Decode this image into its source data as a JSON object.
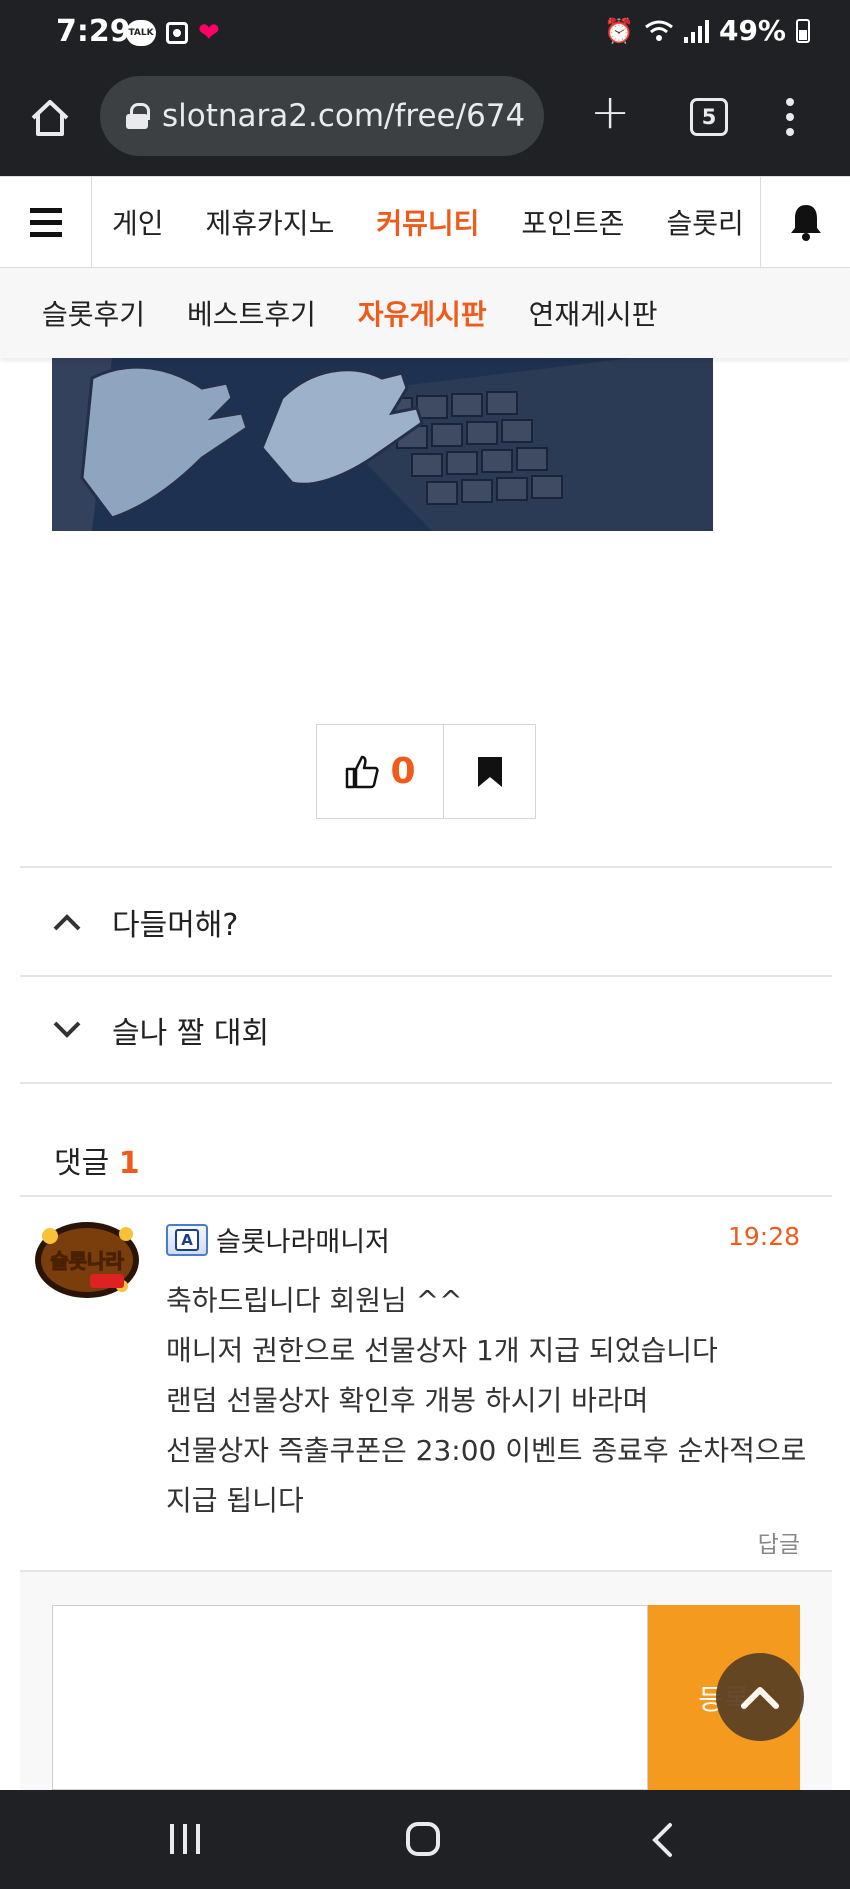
{
  "status_bar": {
    "time": "7:29",
    "battery": "49%",
    "left_icons": [
      "kakaotalk-icon",
      "camera-app-icon",
      "heart-icon"
    ],
    "right_icons": [
      "alarm-icon",
      "wifi-icon",
      "signal-icon",
      "battery-icon"
    ]
  },
  "browser": {
    "url": "slotnara2.com/free/674",
    "tab_count": "5"
  },
  "site_nav": {
    "items": [
      {
        "label": "게인",
        "active": false
      },
      {
        "label": "제휴카지노",
        "active": false
      },
      {
        "label": "커뮤니티",
        "active": true
      },
      {
        "label": "포인트존",
        "active": false
      },
      {
        "label": "슬롯리",
        "active": false
      }
    ]
  },
  "sub_nav": {
    "items": [
      {
        "label": "슬롯후기",
        "active": false
      },
      {
        "label": "베스트후기",
        "active": false
      },
      {
        "label": "자유게시판",
        "active": true
      },
      {
        "label": "연재게시판",
        "active": false
      }
    ]
  },
  "post_actions": {
    "like_count": "0"
  },
  "prev_next": {
    "prev_title": "다들머해?",
    "next_title": "슬나 짤 대회"
  },
  "comments": {
    "label": "댓글",
    "count": "1",
    "items": [
      {
        "author": "슬롯나라매니저",
        "badge": "A",
        "avatar_text": "슬롯나라",
        "time": "19:28",
        "lines": [
          "축하드립니다 회원님 ^^",
          "매니저 권한으로 선물상자 1개 지급 되었습니다",
          "랜덤 선물상자 확인후 개봉 하시기 바라며",
          "선물상자 즉출쿠폰은 23:00 이벤트 종료후 순차적으로",
          "지급 됩니다"
        ],
        "reply_label": "답글"
      }
    ]
  },
  "comment_form": {
    "submit_label": "등록"
  },
  "colors": {
    "accent": "#f05a1a",
    "submit": "#f39a1f",
    "dark_bar": "#202124"
  }
}
